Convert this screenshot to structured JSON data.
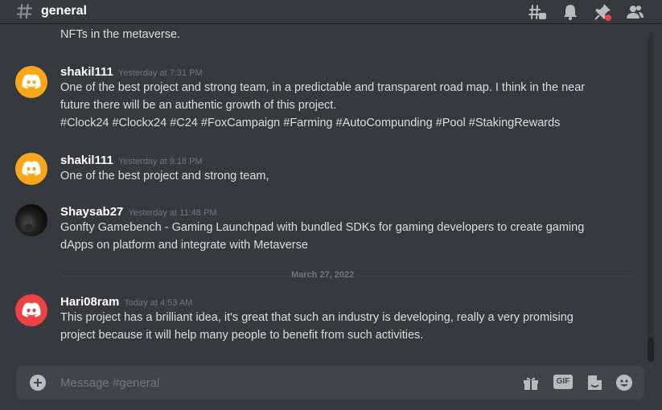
{
  "header": {
    "channel_name": "general",
    "icons": [
      "hash-icon",
      "threads-icon",
      "bell-icon",
      "pin-icon",
      "members-icon"
    ],
    "pin_notification_color": "#ed4245"
  },
  "messages": {
    "cont_line": "NFTs in the metaverse.",
    "groups": [
      {
        "username": "shakil111",
        "timestamp": "Yesterday at 7:31 PM",
        "avatar": "discord-logo-orange",
        "lines": [
          "One of the best project and strong team, in a predictable and transparent road map. I think in the near",
          "future there will be an authentic growth of this project.",
          "#Clock24 #Clockx24 #C24 #FoxCampaign #Farming #AutoCompunding #Pool #StakingRewards"
        ]
      },
      {
        "username": "shakil111",
        "timestamp": "Yesterday at 9:18 PM",
        "avatar": "discord-logo-orange",
        "lines": [
          "One of the best project and strong team,"
        ]
      },
      {
        "username": "Shaysab27",
        "timestamp": "Yesterday at 11:48 PM",
        "avatar": "user-photo",
        "lines": [
          "Gonfty Gamebench - Gaming Launchpad with bundled SDKs for gaming developers to create gaming",
          "dApps on platform and integrate with Metaverse"
        ]
      },
      {
        "username": "Hari08ram",
        "timestamp": "Today at 4:53 AM",
        "avatar": "discord-logo-red",
        "lines": [
          "This project has a brilliant idea, it's great that such an industry is developing, really a very promising",
          "project because it will help many people to benefit from such activities."
        ]
      }
    ],
    "date_divider": "March 27, 2022"
  },
  "composer": {
    "placeholder": "Message #general",
    "gif_label": "GIF",
    "icons": [
      "plus-icon",
      "gift-icon",
      "gif-icon",
      "sticker-icon",
      "emoji-icon"
    ]
  },
  "colors": {
    "background": "#36393f",
    "composer_bg": "#40444b",
    "avatar_orange": "#faa61a",
    "avatar_red": "#ed4245",
    "username": "#ffffff",
    "timestamp": "#72767d"
  }
}
